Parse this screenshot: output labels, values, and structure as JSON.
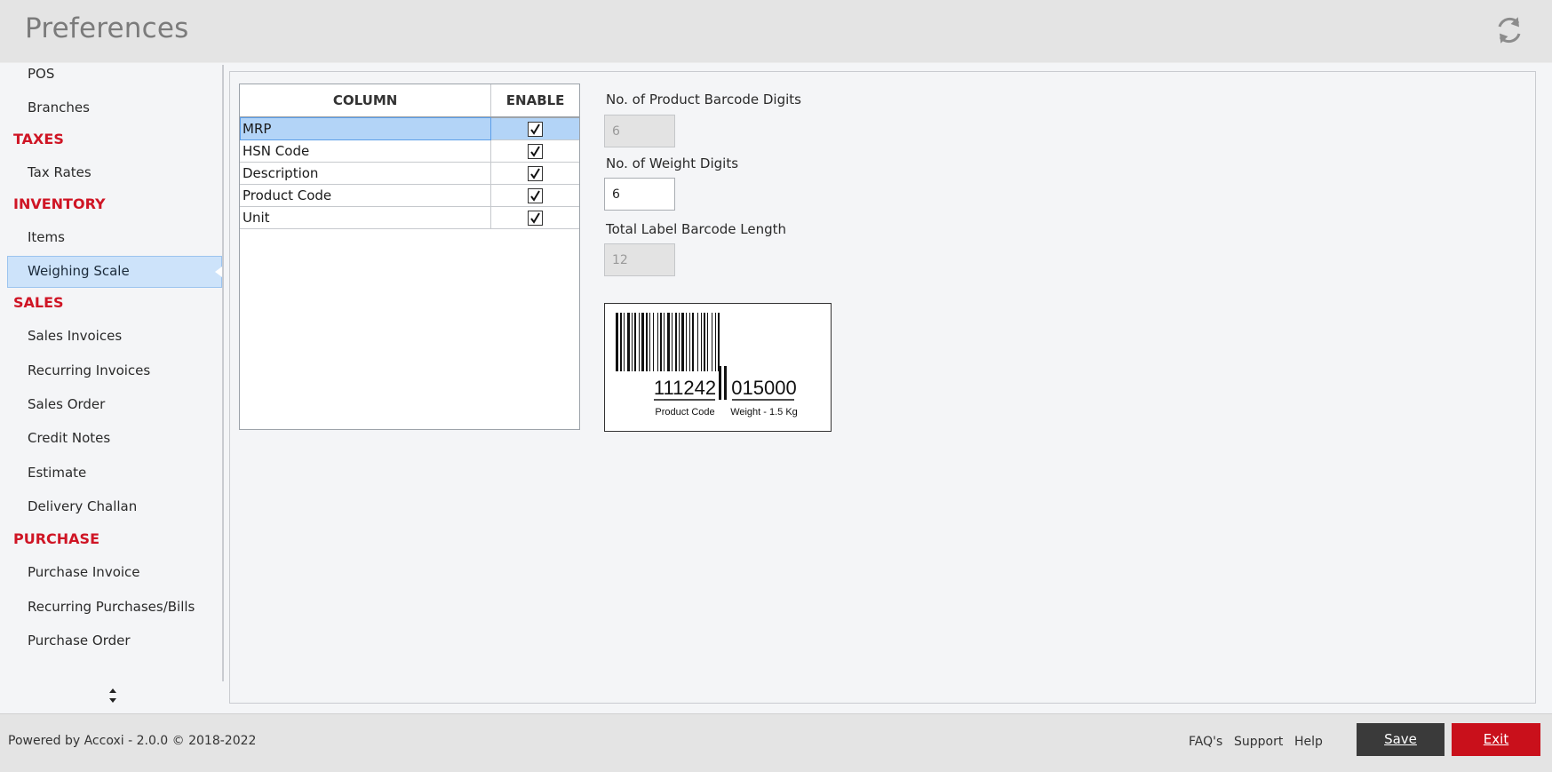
{
  "window": {
    "title": "Preferences",
    "refresh_icon": "refresh-icon"
  },
  "sidebar": {
    "pos": "POS",
    "branches": "Branches",
    "taxes": "TAXES",
    "tax_rates": "Tax Rates",
    "inventory": "INVENTORY",
    "items": "Items",
    "weighing_scale": "Weighing Scale",
    "sales": "SALES",
    "sales_invoices": "Sales Invoices",
    "recurring_invoices": "Recurring Invoices",
    "sales_order": "Sales Order",
    "credit_notes": "Credit Notes",
    "estimate": "Estimate",
    "delivery_challan": "Delivery Challan",
    "purchase": "PURCHASE",
    "purchase_invoice": "Purchase Invoice",
    "recurring_purchases": "Recurring Purchases/Bills",
    "purchase_order": "Purchase Order"
  },
  "grid": {
    "headers": {
      "column": "COLUMN",
      "enable": "ENABLE"
    },
    "rows": [
      {
        "column": "MRP",
        "enabled": true
      },
      {
        "column": "HSN Code",
        "enabled": true
      },
      {
        "column": "Description",
        "enabled": true
      },
      {
        "column": "Product Code",
        "enabled": true
      },
      {
        "column": "Unit",
        "enabled": true
      }
    ]
  },
  "form": {
    "barcode_digits_label": "No. of Product Barcode Digits",
    "barcode_digits_value": "6",
    "weight_digits_label": "No. of Weight Digits",
    "weight_digits_value": "6",
    "total_length_label": "Total Label Barcode Length",
    "total_length_value": "12"
  },
  "barcode_preview": {
    "product_code": "111242",
    "weight_code": "015000",
    "product_caption": "Product Code",
    "weight_caption": "Weight - 1.5 Kg"
  },
  "footer": {
    "powered": "Powered by Accoxi - 2.0.0 © 2018-2022",
    "faq": "FAQ's",
    "support": "Support",
    "help": "Help",
    "save": "Save",
    "exit": "Exit"
  },
  "colors": {
    "accent_red": "#cf1525",
    "selection": "#cde3fa",
    "save_button": "#3a3a3a",
    "exit_button": "#c9101b"
  }
}
